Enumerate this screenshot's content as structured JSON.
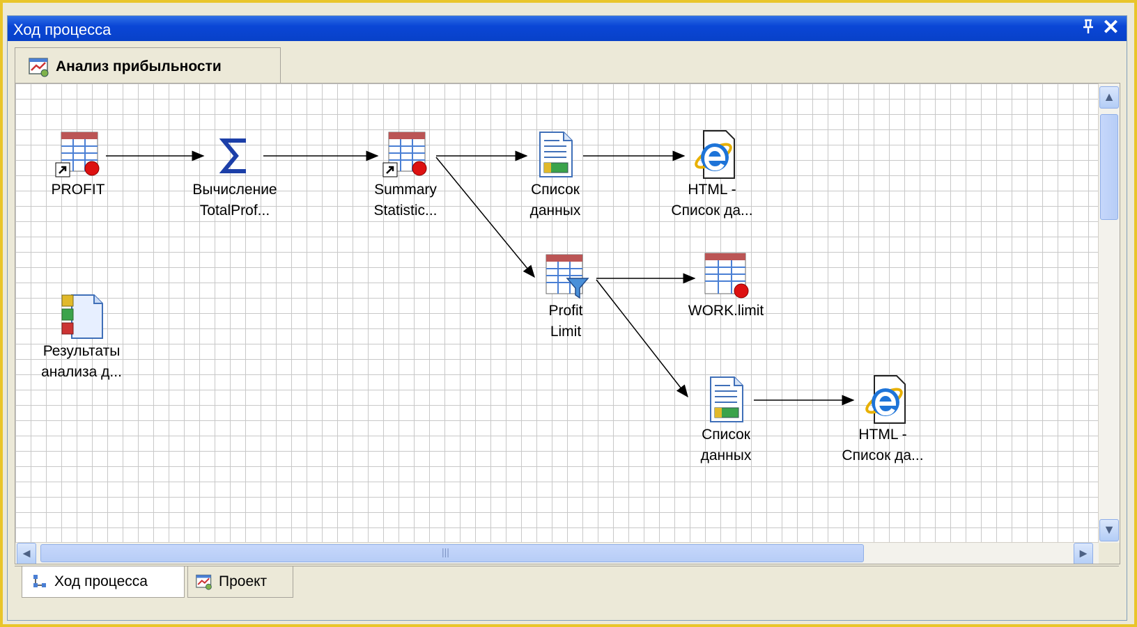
{
  "window": {
    "title": "Ход процесса",
    "pin_glyph": "ꟼ",
    "close_glyph": "✕"
  },
  "doc_tab": {
    "label": "Анализ прибыльности",
    "icon": "project-icon"
  },
  "nodes": [
    {
      "id": "profit",
      "icon": "table-shortcut-icon",
      "label1": "PROFIT",
      "label2": ""
    },
    {
      "id": "calc",
      "icon": "sigma-icon",
      "label1": "Вычисление",
      "label2": "TotalProf..."
    },
    {
      "id": "summary",
      "icon": "table-shortcut-icon",
      "label1": "Summary",
      "label2": "Statistic..."
    },
    {
      "id": "list1",
      "icon": "report-icon",
      "label1": "Список",
      "label2": "данных"
    },
    {
      "id": "html1",
      "icon": "internet-explorer-icon",
      "label1": "HTML -",
      "label2": "Список да..."
    },
    {
      "id": "filter",
      "icon": "filter-table-icon",
      "label1": "Profit",
      "label2": "Limit"
    },
    {
      "id": "worklimit",
      "icon": "table-icon",
      "label1": "WORK.limit",
      "label2": ""
    },
    {
      "id": "results",
      "icon": "results-icon",
      "label1": "Результаты",
      "label2": "анализа д..."
    },
    {
      "id": "list2",
      "icon": "report-icon",
      "label1": "Список",
      "label2": "данных"
    },
    {
      "id": "html2",
      "icon": "internet-explorer-icon",
      "label1": "HTML -",
      "label2": "Список да..."
    }
  ],
  "scroll": {
    "up": "▲",
    "down": "▼",
    "left": "◄",
    "right": "►",
    "grip": "|||"
  },
  "bottom_tabs": [
    {
      "label": "Ход процесса",
      "icon": "process-flow-icon"
    },
    {
      "label": "Проект",
      "icon": "project-icon"
    }
  ]
}
